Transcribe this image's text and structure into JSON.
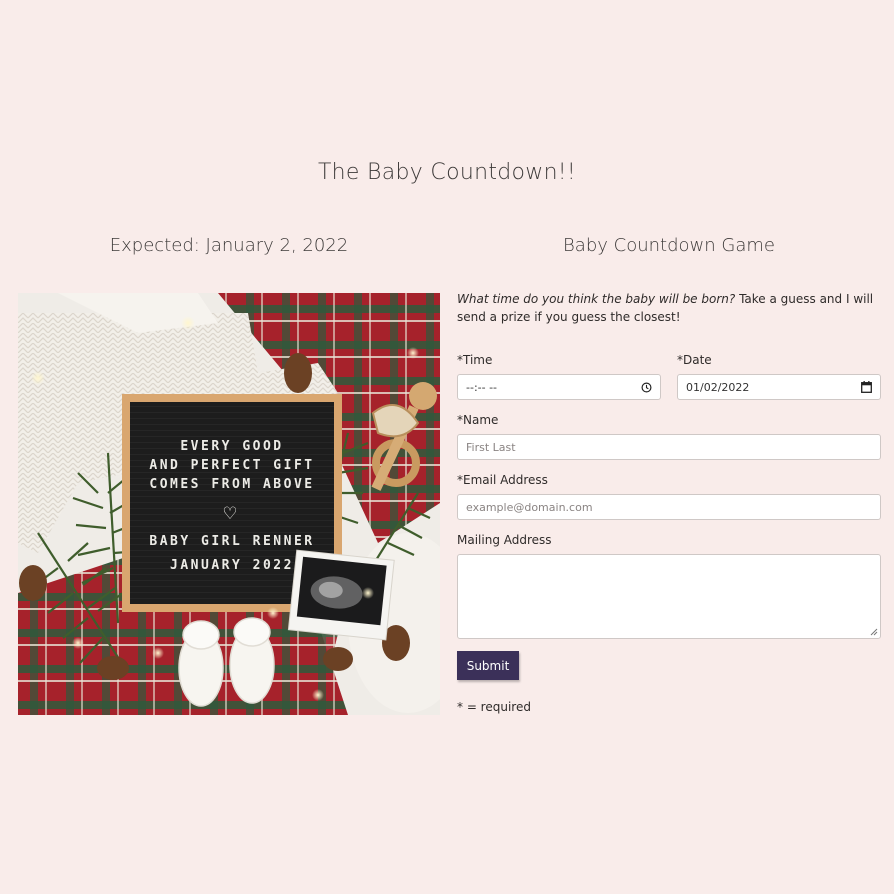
{
  "page": {
    "title": "The Baby Countdown!!",
    "left_heading": "Expected: January 2, 2022",
    "right_heading": "Baby Countdown Game"
  },
  "photo": {
    "sign_lines": [
      "EVERY GOOD",
      "AND PERFECT GIFT",
      "COMES FROM ABOVE",
      "BABY GIRL RENNER",
      "JANUARY 2022"
    ],
    "heart_glyph": "♡"
  },
  "form": {
    "intro_italic": "What time do you think the baby will be born?",
    "intro_rest": " Take a guess and I will send a prize if you guess the closest!",
    "time_label": "*Time",
    "time_value": "--:-- --",
    "date_label": "*Date",
    "date_value": "01/02/2022",
    "name_label": "*Name",
    "name_placeholder": "First Last",
    "email_label": "*Email Address",
    "email_placeholder": "example@domain.com",
    "mailing_label": "Mailing Address",
    "mailing_value": "",
    "submit_label": "Submit",
    "required_note": "* = required"
  },
  "colors": {
    "background": "#f9ecea",
    "submit_bg": "#3b3059"
  },
  "icons": {
    "time": "clock-icon",
    "date": "calendar-icon",
    "resize": "resize-grip-icon"
  }
}
